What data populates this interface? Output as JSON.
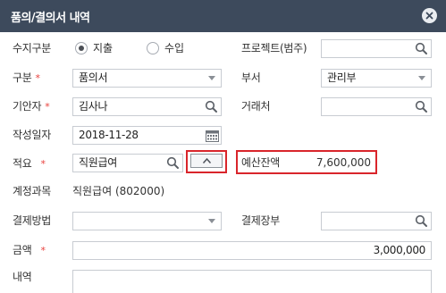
{
  "dialog": {
    "title": "품의/결의서 내역",
    "close_icon": "close-icon"
  },
  "form": {
    "income_expense": {
      "label": "수지구분",
      "options": [
        "지출",
        "수입"
      ],
      "selected": "지출"
    },
    "project": {
      "label": "프로젝트(범주)",
      "value": ""
    },
    "category": {
      "label": "구분",
      "value": "품의서"
    },
    "department": {
      "label": "부서",
      "value": "관리부"
    },
    "drafter": {
      "label": "기안자",
      "value": "김사나"
    },
    "vendor": {
      "label": "거래처",
      "value": ""
    },
    "date": {
      "label": "작성일자",
      "value": "2018-11-28"
    },
    "summary": {
      "label": "적요",
      "value": "직원급여"
    },
    "budget": {
      "label": "예산잔액",
      "value": "7,600,000"
    },
    "account": {
      "label": "계정과목",
      "value": "직원급여 (802000)"
    },
    "payment_method": {
      "label": "결제방법",
      "value": ""
    },
    "payment_ledger": {
      "label": "결제장부",
      "value": ""
    },
    "amount": {
      "label": "금액",
      "value": "3,000,000"
    },
    "details": {
      "label": "내역",
      "value": ""
    }
  },
  "required_mark": "*"
}
